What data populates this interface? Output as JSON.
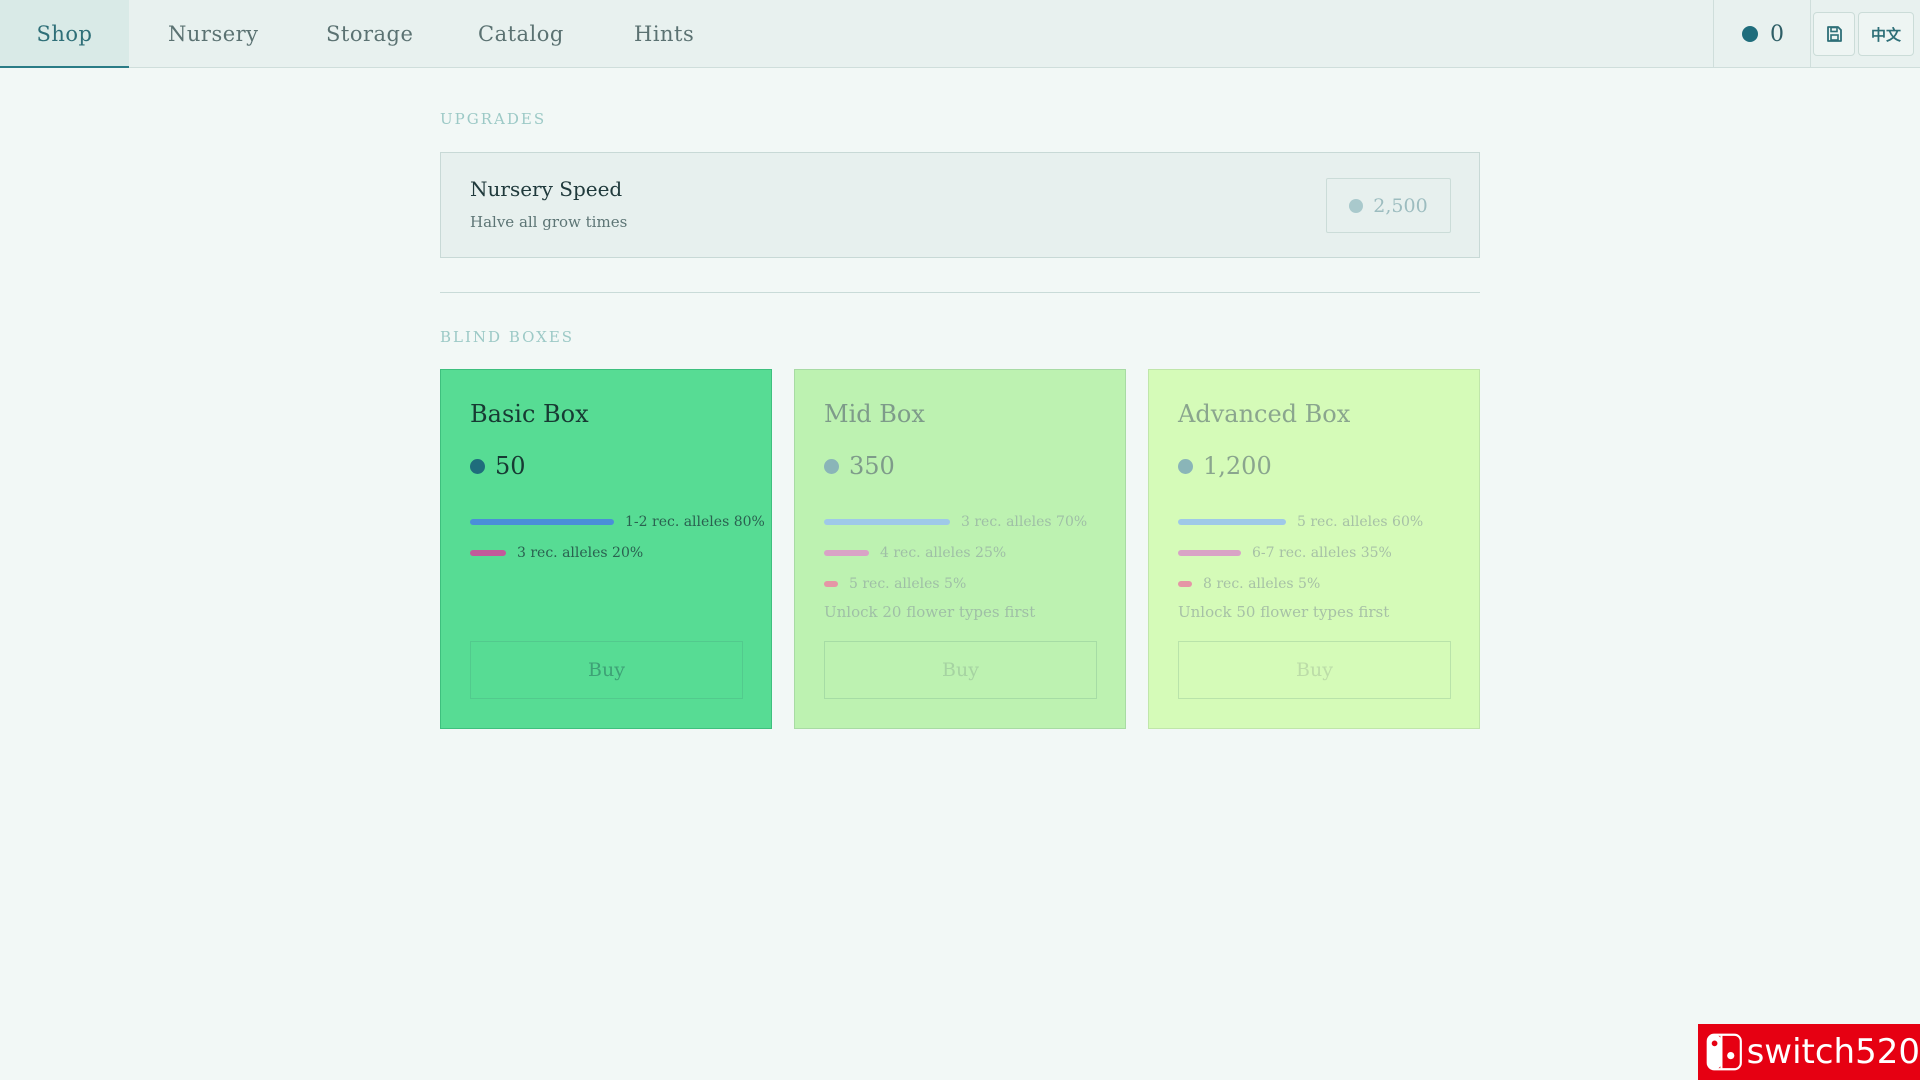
{
  "nav": {
    "tabs": [
      {
        "label": "Shop",
        "active": true
      },
      {
        "label": "Nursery",
        "active": false
      },
      {
        "label": "Storage",
        "active": false
      },
      {
        "label": "Catalog",
        "active": false
      },
      {
        "label": "Hints",
        "active": false
      }
    ],
    "coin_balance": "0",
    "save_icon": "save-icon",
    "language_label": "中文"
  },
  "upgrades": {
    "section_label": "UPGRADES",
    "items": [
      {
        "name": "Nursery Speed",
        "description": "Halve all grow times",
        "price": "2,500"
      }
    ]
  },
  "blind_boxes": {
    "section_label": "BLIND BOXES",
    "items": [
      {
        "name": "Basic Box",
        "price": "50",
        "locked": false,
        "background": "#57dc94",
        "odds": [
          {
            "label": "1-2 rec. alleles 80%",
            "percent": 80,
            "color": "#4a8fd8"
          },
          {
            "label": "3 rec. alleles 20%",
            "percent": 20,
            "color": "#c25a9a"
          }
        ],
        "unlock_note": "",
        "buy_label": "Buy"
      },
      {
        "name": "Mid Box",
        "price": "350",
        "locked": true,
        "background": "#bdf2b1",
        "odds": [
          {
            "label": "3 rec. alleles 70%",
            "percent": 70,
            "color": "#9fc9e8"
          },
          {
            "label": "4 rec. alleles 25%",
            "percent": 25,
            "color": "#d9a3c6"
          },
          {
            "label": "5 rec. alleles 5%",
            "percent": 5,
            "color": "#e596a6"
          }
        ],
        "unlock_note": "Unlock 20 flower types first",
        "buy_label": "Buy"
      },
      {
        "name": "Advanced Box",
        "price": "1,200",
        "locked": true,
        "background": "#d5fbb8",
        "odds": [
          {
            "label": "5 rec. alleles 60%",
            "percent": 60,
            "color": "#9fc9e8"
          },
          {
            "label": "6-7 rec. alleles 35%",
            "percent": 35,
            "color": "#d9a3c6"
          },
          {
            "label": "8 rec. alleles 5%",
            "percent": 5,
            "color": "#e596a6"
          }
        ],
        "unlock_note": "Unlock 50 flower types first",
        "buy_label": "Buy"
      }
    ]
  },
  "watermark": {
    "text": "switch520",
    "logo_icon": "nintendo-switch-logo-icon",
    "color": "#e60012"
  }
}
